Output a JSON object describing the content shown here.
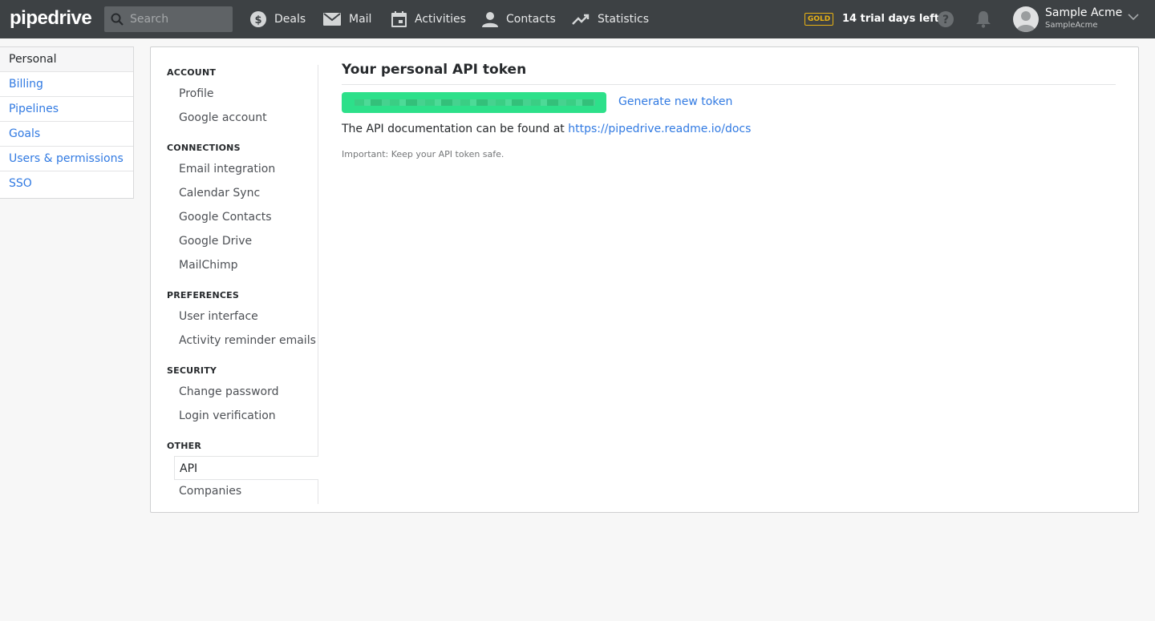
{
  "topbar": {
    "logo": "pipedrive",
    "search_placeholder": "Search",
    "nav": [
      {
        "label": "Deals",
        "icon": "deals-icon"
      },
      {
        "label": "Mail",
        "icon": "mail-icon"
      },
      {
        "label": "Activities",
        "icon": "calendar-icon"
      },
      {
        "label": "Contacts",
        "icon": "person-icon"
      },
      {
        "label": "Statistics",
        "icon": "trend-icon"
      }
    ],
    "plan_badge": "GOLD",
    "trial_text": "14 trial days left",
    "user_name": "Sample Acme",
    "user_company": "SampleAcme"
  },
  "leftnav": {
    "items": [
      {
        "label": "Personal",
        "active": true
      },
      {
        "label": "Billing"
      },
      {
        "label": "Pipelines"
      },
      {
        "label": "Goals"
      },
      {
        "label": "Users & permissions"
      },
      {
        "label": "SSO"
      }
    ]
  },
  "subnav": {
    "sections": [
      {
        "heading": "ACCOUNT",
        "items": [
          "Profile",
          "Google account"
        ]
      },
      {
        "heading": "CONNECTIONS",
        "items": [
          "Email integration",
          "Calendar Sync",
          "Google Contacts",
          "Google Drive",
          "MailChimp"
        ]
      },
      {
        "heading": "PREFERENCES",
        "items": [
          "User interface",
          "Activity reminder emails"
        ]
      },
      {
        "heading": "SECURITY",
        "items": [
          "Change password",
          "Login verification"
        ]
      },
      {
        "heading": "OTHER",
        "items": [
          "API",
          "Companies"
        ]
      }
    ],
    "active_item": "API"
  },
  "content": {
    "title": "Your personal API token",
    "generate_label": "Generate new token",
    "doc_text": "The API documentation can be found at ",
    "doc_link": "https://pipedrive.readme.io/docs",
    "note": "Important: Keep your API token safe."
  },
  "colors": {
    "topbar": "#3d4144",
    "link": "#317ae2",
    "token": "#2de08a",
    "gold": "#e8b214"
  }
}
